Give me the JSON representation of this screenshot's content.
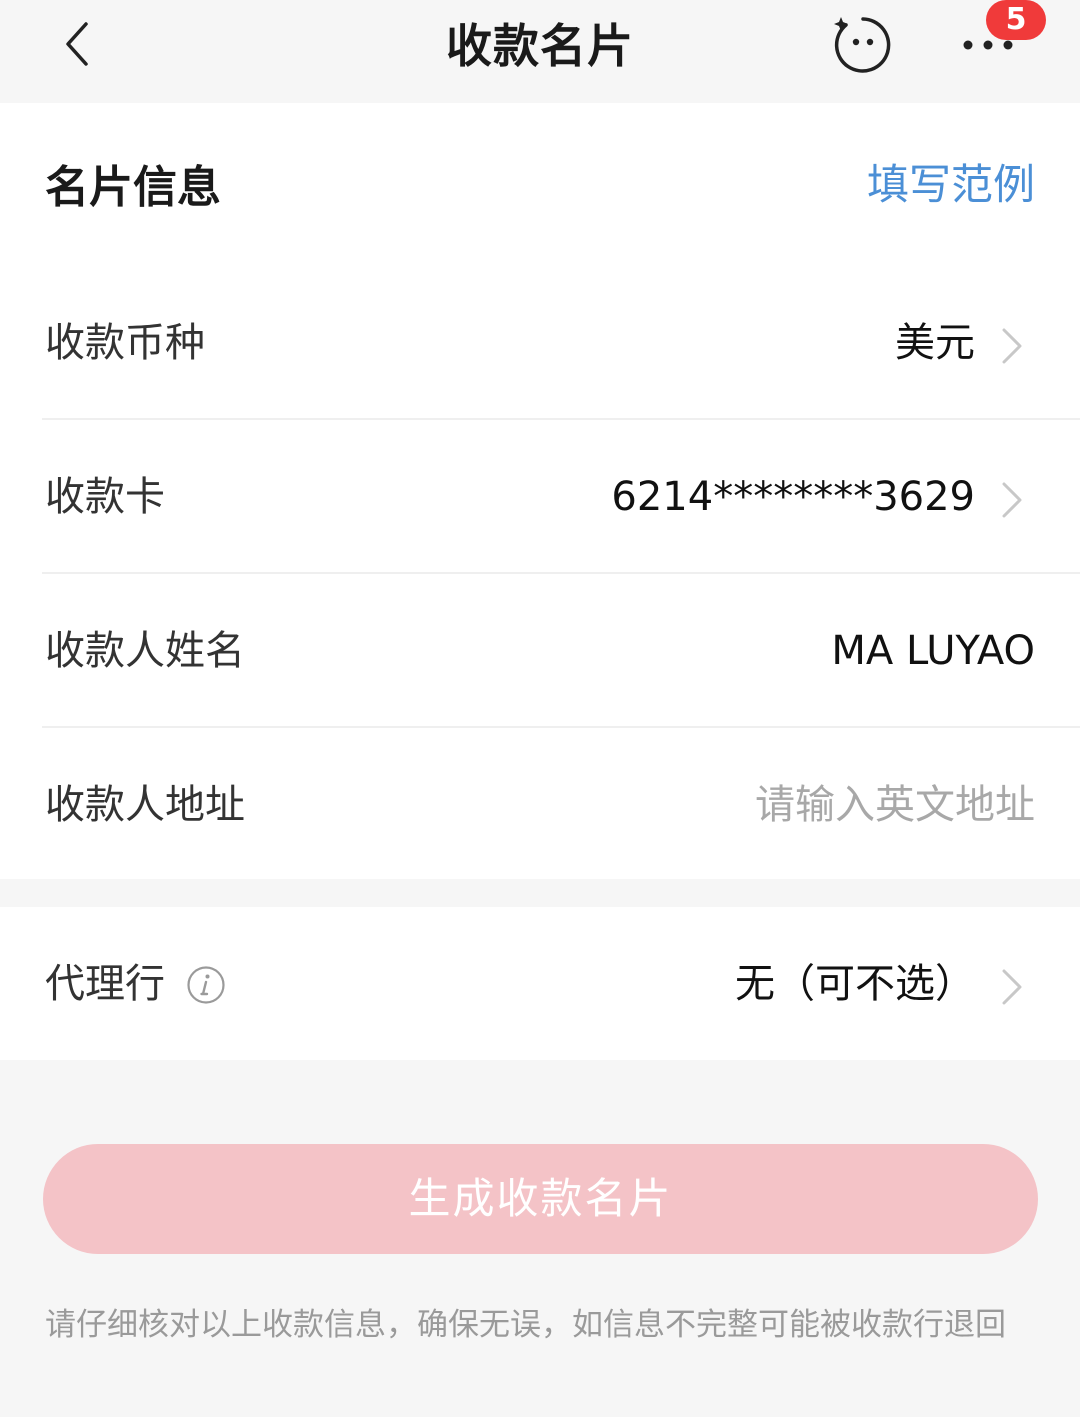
{
  "header": {
    "title": "收款名片",
    "badge_count": "5",
    "icons": [
      "back-arrow-icon",
      "face-service-icon",
      "more-dots-icon"
    ]
  },
  "card_info": {
    "section_title": "名片信息",
    "example_link": "填写范例",
    "rows": [
      {
        "label": "收款币种",
        "value": "美元"
      },
      {
        "label": "收款卡",
        "value": "6214********3629"
      },
      {
        "label": "收款人姓名",
        "value": "MA LUYAO"
      },
      {
        "label": "收款人地址",
        "placeholder": "请输入英文地址"
      }
    ]
  },
  "agent_bank": {
    "label": "代理行",
    "value": "无（可不选）"
  },
  "submit_button": "生成收款名片",
  "note": "请仔细核对以上收款信息，确保无误，如信息不完整可能被收款行退回",
  "colors": {
    "link": "#4b8fd6",
    "badge": "#f03a3a",
    "button_disabled": "#f4c3c7",
    "placeholder": "#a8a8a8"
  }
}
